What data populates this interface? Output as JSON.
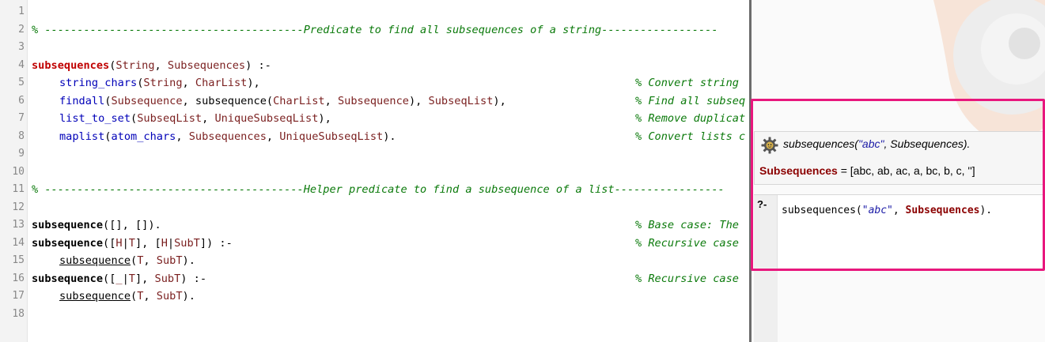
{
  "editor": {
    "line_numbers": [
      "1",
      "2",
      "3",
      "4",
      "5",
      "6",
      "7",
      "8",
      "9",
      "10",
      "11",
      "12",
      "13",
      "14",
      "15",
      "16",
      "17",
      "18"
    ],
    "header1": "% ----------------------------------------Predicate to find all subsequences of a string------------------",
    "l4_name": "subsequences",
    "l4_open": "(",
    "l4_a1": "String",
    "l4_sep": ", ",
    "l4_a2": "Subsequences",
    "l4_close": ") :-",
    "l5_pred": "string_chars",
    "l5_open": "(",
    "l5_a1": "String",
    "l5_sep": ", ",
    "l5_a2": "CharList",
    "l5_close": "),",
    "l5_comment": "% Convert string",
    "l6_pred": "findall",
    "l6_open": "(",
    "l6_a1": "Subsequence",
    "l6_sep1": ", subsequence(",
    "l6_a2": "CharList",
    "l6_sep2": ", ",
    "l6_a3": "Subsequence",
    "l6_sep3": "), ",
    "l6_a4": "SubseqList",
    "l6_close": "),",
    "l6_comment": "% Find all subseq",
    "l7_pred": "list_to_set",
    "l7_open": "(",
    "l7_a1": "SubseqList",
    "l7_sep": ", ",
    "l7_a2": "UniqueSubseqList",
    "l7_close": "),",
    "l7_comment": "% Remove duplicat",
    "l8_pred": "maplist",
    "l8_open": "(",
    "l8_a0": "atom_chars",
    "l8_sep0": ", ",
    "l8_a1": "Subsequences",
    "l8_sep": ", ",
    "l8_a2": "UniqueSubseqList",
    "l8_close": ").",
    "l8_comment": "% Convert lists c",
    "header2": "% ----------------------------------------Helper predicate to find a subsequence of a list-----------------",
    "l13_name": "subsequence",
    "l13_rest": "([], []).",
    "l13_comment": "% Base case: The",
    "l14_name": "subsequence",
    "l14_p1": "([",
    "l14_v1": "H",
    "l14_p2": "|",
    "l14_v2": "T",
    "l14_p3": "], [",
    "l14_v3": "H",
    "l14_p4": "|",
    "l14_v4": "SubT",
    "l14_p5": "]) :-",
    "l14_comment": "% Recursive case",
    "l15_call": "subsequence",
    "l15_p1": "(",
    "l15_v1": "T",
    "l15_p2": ", ",
    "l15_v2": "SubT",
    "l15_p3": ").",
    "l16_name": "subsequence",
    "l16_p1": "([",
    "l16_v1": "_",
    "l16_p2": "|",
    "l16_v2": "T",
    "l16_p3": "], ",
    "l16_v3": "SubT",
    "l16_p4": ") :-",
    "l16_comment": "% Recursive case",
    "l17_call": "subsequence",
    "l17_p1": "(",
    "l17_v1": "T",
    "l17_p2": ", ",
    "l17_v2": "SubT",
    "l17_p3": ")."
  },
  "result": {
    "gear_icon": "gear-icon",
    "echo_pred": "subsequences(",
    "echo_arg": "\"abc\"",
    "echo_rest": ", Subsequences).",
    "answer_var": "Subsequences",
    "answer_value": " = [abc, ab, ac, a, bc, b, c, '']"
  },
  "input": {
    "prompt": "?-",
    "pred": "subsequences(",
    "arg": "\"abc\"",
    "sep": ", ",
    "var": "Subsequences",
    "close": ")."
  },
  "colors": {
    "highlight": "#e8177d",
    "comment": "#0b7a0b",
    "head": "#c00000",
    "variable": "#7a1f1f",
    "builtin": "#0000b8"
  }
}
